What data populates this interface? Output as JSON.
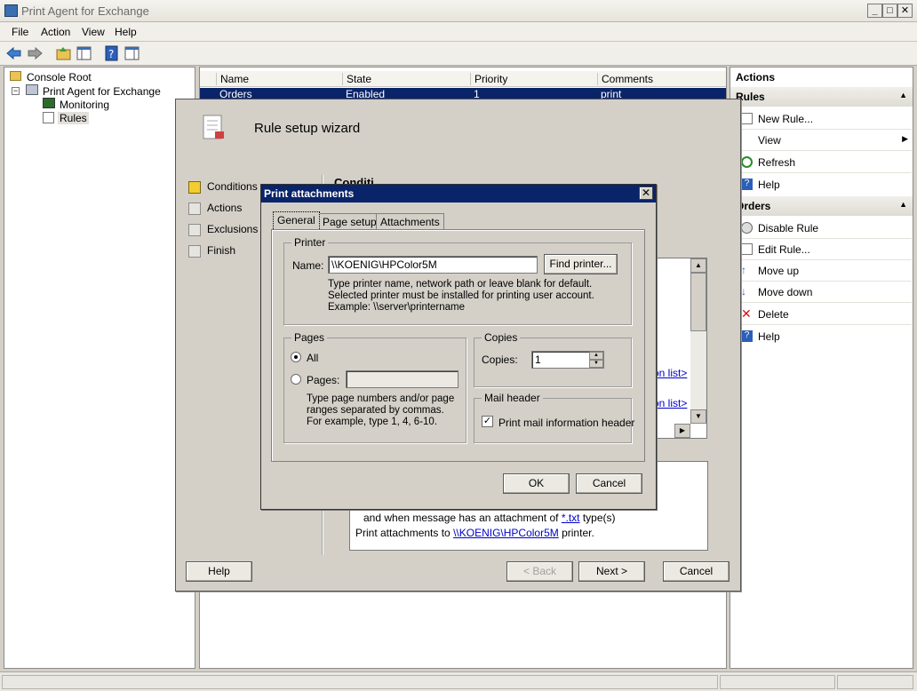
{
  "window": {
    "title": "Print Agent for Exchange"
  },
  "menu": [
    "File",
    "Action",
    "View",
    "Help"
  ],
  "tree": {
    "root": "Console Root",
    "app": "Print Agent for Exchange",
    "children": [
      "Monitoring",
      "Rules"
    ]
  },
  "list": {
    "columns": [
      "Name",
      "State",
      "Priority",
      "Comments"
    ],
    "rows": [
      {
        "name": "Orders",
        "state": "Enabled",
        "priority": "1",
        "comments": "print"
      }
    ]
  },
  "actions": {
    "header": "Actions",
    "rules_section": "Rules",
    "rules_items": [
      {
        "label": "New Rule...",
        "icon": "new-rule-icon"
      },
      {
        "label": "View",
        "icon": "none"
      },
      {
        "label": "Refresh",
        "icon": "refresh-icon"
      },
      {
        "label": "Help",
        "icon": "help-icon"
      }
    ],
    "orders_section": "Orders",
    "orders_items": [
      {
        "label": "Disable Rule",
        "icon": "disable-icon"
      },
      {
        "label": "Edit Rule...",
        "icon": "edit-icon"
      },
      {
        "label": "Move up",
        "icon": "arrow-up-icon"
      },
      {
        "label": "Move down",
        "icon": "arrow-down-icon"
      },
      {
        "label": "Delete",
        "icon": "delete-icon"
      },
      {
        "label": "Help",
        "icon": "help-icon"
      }
    ]
  },
  "wizard": {
    "title": "Rule setup wizard",
    "steps": [
      "Conditions",
      "Actions",
      "Exclusions",
      "Finish"
    ],
    "heading_partial": "Conditi",
    "link1": "on list>",
    "link2": "on list>",
    "summary_line1_pre": "and when message has an attachment of ",
    "summary_line1_link": "*.txt",
    "summary_line1_post": " type(s)",
    "summary_line2_pre": "Print attachments to ",
    "summary_line2_link": "\\\\KOENIG\\HPColor5M",
    "summary_line2_post": " printer.",
    "buttons": {
      "help": "Help",
      "back": "< Back",
      "next": "Next >",
      "cancel": "Cancel"
    }
  },
  "dialog": {
    "title": "Print attachments",
    "tabs": [
      "General",
      "Page setup",
      "Attachments"
    ],
    "printer_group": "Printer",
    "name_label": "Name:",
    "name_value": "\\\\KOENIG\\HPColor5M",
    "find_button": "Find printer...",
    "printer_help": [
      "Type printer name, network path or leave blank for default.",
      "Selected printer must be installed for printing user account.",
      "Example: \\\\server\\printername"
    ],
    "pages_group": "Pages",
    "all_label": "All",
    "pages_label": "Pages:",
    "pages_value": "",
    "pages_help": [
      "Type page numbers and/or page",
      "ranges separated by commas.",
      "For example, type 1, 4, 6-10."
    ],
    "copies_group": "Copies",
    "copies_label": "Copies:",
    "copies_value": "1",
    "mail_group": "Mail header",
    "mail_label": "Print mail information header",
    "mail_checked": true,
    "ok": "OK",
    "cancel": "Cancel"
  }
}
